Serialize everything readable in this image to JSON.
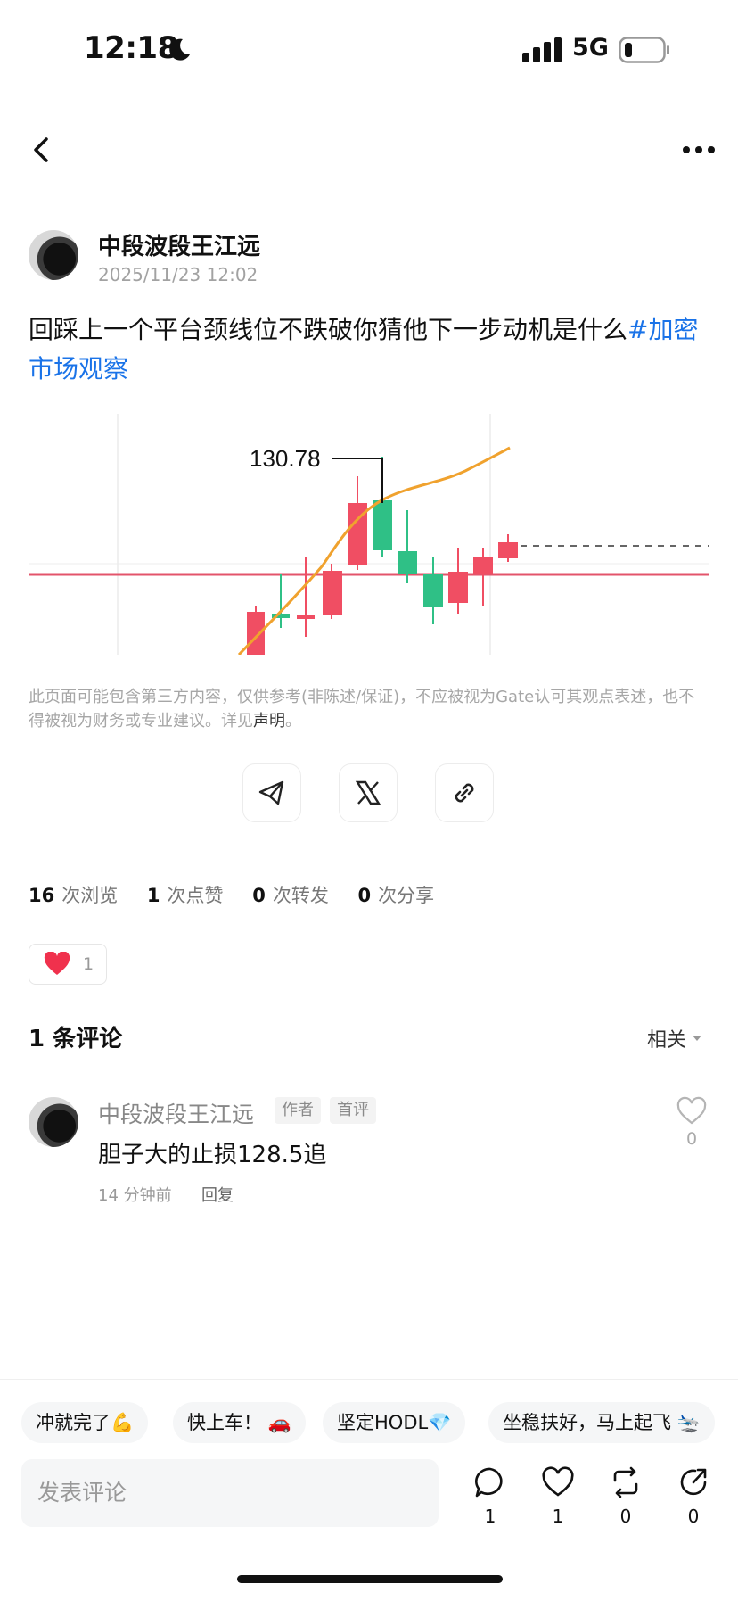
{
  "status_bar": {
    "time": "12:18",
    "network": "5G"
  },
  "post": {
    "author": "中段波段王江远",
    "date": "2025/11/23 12:02",
    "text": "回踩上一个平台颈线位不跌破你猜他下一步动机是什么",
    "hashtag": "#加密市场观察",
    "chart_label": "130.78"
  },
  "disclaimer": {
    "text": "此页面可能包含第三方内容，仅供参考(非陈述/保证)，不应被视为Gate认可其观点表述，也不得被视为财务或专业建议。详见",
    "link": "声明",
    "suffix": "。"
  },
  "stats": [
    {
      "count": "16",
      "label": "次浏览"
    },
    {
      "count": "1",
      "label": "次点赞"
    },
    {
      "count": "0",
      "label": "次转发"
    },
    {
      "count": "0",
      "label": "次分享"
    }
  ],
  "reaction": {
    "count": "1"
  },
  "comments": {
    "count_label": "1 条评论",
    "sort_label": "相关",
    "items": [
      {
        "author": "中段波段王江远",
        "badge_author": "作者",
        "badge_first": "首评",
        "text": "胆子大的止损128.5追",
        "time": "14 分钟前",
        "reply": "回复",
        "likes": "0"
      }
    ]
  },
  "quick_replies": [
    "冲就完了💪",
    "快上车！ 🚗",
    "坚定HODL💎",
    "坐稳扶好，马上起飞 🛬"
  ],
  "composer": {
    "placeholder": "发表评论"
  },
  "actions": [
    {
      "icon": "comment-icon",
      "count": "1"
    },
    {
      "icon": "like-icon",
      "count": "1"
    },
    {
      "icon": "repost-icon",
      "count": "0"
    },
    {
      "icon": "share-icon",
      "count": "0"
    }
  ],
  "colors": {
    "link": "#1a73e8",
    "up": "#2fc086",
    "down": "#f04e63",
    "ma": "#f0a22e"
  }
}
